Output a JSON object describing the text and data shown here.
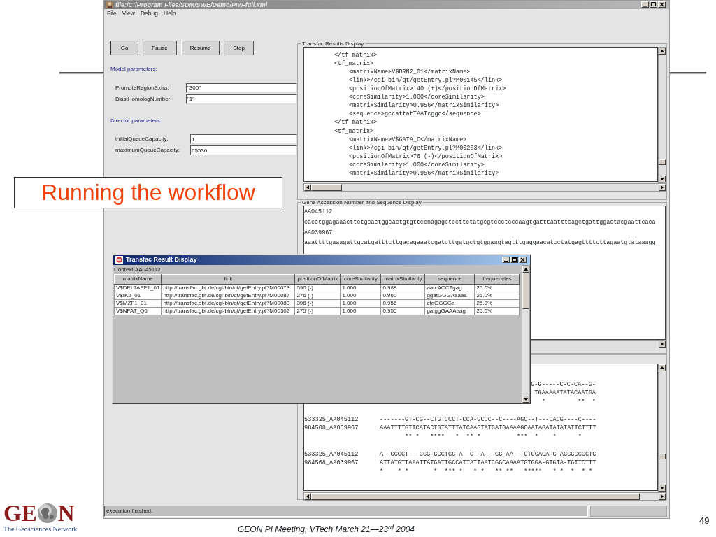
{
  "slide": {
    "callout": "Running the workflow",
    "footer": "GEON PI Meeting, VTech March 21—23$^{rd}$ 2004",
    "page_number": "49",
    "logo": {
      "left": "GE",
      "right": "N",
      "tagline": "The Geosciences Network"
    }
  },
  "window": {
    "title": "file:/C:/Program Files/SDM/SWE/Demo/PIW-full.xml"
  },
  "menu": [
    "File",
    "View",
    "Debug",
    "Help"
  ],
  "buttons": [
    "Go",
    "Pause",
    "Resume",
    "Stop"
  ],
  "sections": [
    {
      "title": "Model parameters:",
      "fields": [
        {
          "label": "PromoteRegionExtra:",
          "value": "\"300\""
        },
        {
          "label": "BlastHomologNumber:",
          "value": "\"1\""
        }
      ]
    },
    {
      "title": "Director parameters:",
      "fields": [
        {
          "label": "initialQueueCapacity:",
          "value": "1"
        },
        {
          "label": "maximumQueueCapacity:",
          "value": "65536"
        }
      ]
    }
  ],
  "transfac_panel": {
    "title": "Transfac Results Display",
    "lines": [
      {
        "text": "</tf_matrix>"
      },
      {
        "text": "<tf_matrix>",
        "children": [
          {
            "text": "<matrixName>V$BRN2_01</matrixName>"
          },
          {
            "text": "<link>/cgi-bin/qt/getEntry.pl?M00145</link>"
          },
          {
            "text": "<positionOfMatrix>140 (+)</positionOfMatrix>"
          },
          {
            "text": "<coreSimilarity>1.000</coreSimilarity>"
          },
          {
            "text": "<matrixSimilarity>0.956</matrixSimilarity>"
          },
          {
            "text": "<sequence>gccattatTAATcggc</sequence>"
          }
        ]
      },
      {
        "text": "</tf_matrix>"
      },
      {
        "text": "<tf_matrix>",
        "children": [
          {
            "text": "<matrixName>V$GATA_C</matrixName>"
          },
          {
            "text": "<link>/cgi-bin/qt/getEntry.pl?M00203</link>"
          },
          {
            "text": "<positionOfMatrix>76 (-)</positionOfMatrix>"
          },
          {
            "text": "<coreSimilarity>1.000</coreSimilarity>"
          },
          {
            "text": "<matrixSimilarity>0.956</matrixSimilarity>"
          }
        ]
      }
    ]
  },
  "gene_panel": {
    "title": "Gene Accession Number and Sequence Display",
    "lines": [
      "AA045112",
      "cacctggagaaacttctgcactggcactgtgttccnagagctccttctatgcgtccctcccaagtgatttaatttcagctgattggactacgaattcaca",
      "AA039967",
      "aaattttgaaagattgcatgatttcttgacagaaatcgatcttgatgctgtggaagtagtttgaggaacatcctatgagttttcttagaatgtataaagg"
    ]
  },
  "alignment_panel": {
    "blocks": [
      {
        "kind": "partial",
        "rows": [
          {
            "seq": "G-G-----C-C-CA--G-"
          },
          {
            "seq": "TGAAAAATATACAATGA"
          },
          {
            "seq": "*         **  *"
          }
        ]
      },
      {
        "kind": "full",
        "rows": [
          {
            "name": "533325_AA045112",
            "seq": "-------GT-CG--CTGTCCCT-CCA-GCCC--C----AGC--T---CACG----C----"
          },
          {
            "name": "984508_AA039967",
            "seq": "AAATTTTGTTCATACTGTATTTATCAAGTATGATGAAAAGCAATAGATATATATTCTTTT"
          },
          {
            "seq": "       ** *   ****   *  ** *          ***  *    *      *"
          }
        ]
      },
      {
        "kind": "full",
        "rows": [
          {
            "name": "533325_AA045112",
            "seq": "A--GCGCT---CCG-GGCTGC-A--GT-A---GG-AA---GTGGACA-G-AGCGCCCCTC"
          },
          {
            "name": "984508_AA039967",
            "seq": "ATTATGTTAAATTATGATTGCCATTATTAATCGGCAAAATGTGGA-GTGTA-TGTTCTTT"
          },
          {
            "seq": "*    * *       *  *** *   * *   ** **   *****   * *  *  * *"
          }
        ]
      }
    ]
  },
  "status_bar": {
    "text": "execution finished."
  },
  "dialog": {
    "title": "Transfac Result Display",
    "context": "Context:AA045112",
    "columns": [
      "matrixName",
      "link",
      "positionOfMatrix",
      "coreSimilarity",
      "matrixSimilarity",
      "sequence",
      "frequencies"
    ],
    "rows": [
      [
        "V$DELTAEF1_01",
        "http://transfac.gbf.de/cgi-bin/qt/getEntry.pl?M00073",
        "590 (-)",
        "1.000",
        "0.988",
        "aatcACCTgag",
        "25.0%"
      ],
      [
        "V$IK2_01",
        "http://transfac.gbf.de/cgi-bin/qt/getEntry.pl?M00087",
        "276 (-)",
        "1.000",
        "0.960",
        "ggatGGGAaaaa",
        "25.0%"
      ],
      [
        "V$MZF1_01",
        "http://transfac.gbf.de/cgi-bin/qt/getEntry.pl?M00083",
        "396 (-)",
        "1.000",
        "0.956",
        "ctgGGGGa",
        "25.0%"
      ],
      [
        "V$NFAT_Q6",
        "http://transfac.gbf.de/cgi-bin/qt/getEntry.pl?M00302",
        "275 (-)",
        "1.000",
        "0.955",
        "gatggGAAAaag",
        "25.0%"
      ]
    ]
  }
}
